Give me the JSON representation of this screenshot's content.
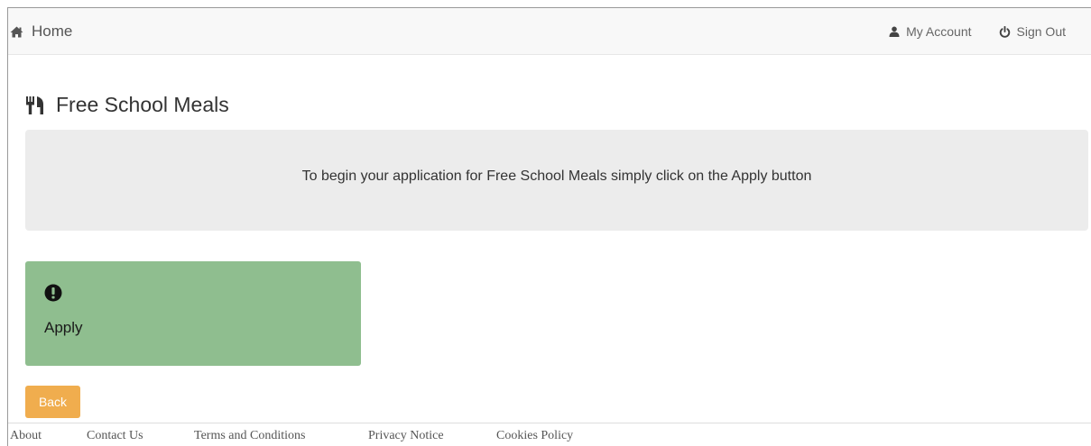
{
  "navbar": {
    "home_label": "Home",
    "home_icon": "home-icon",
    "account_label": "My Account",
    "account_icon": "user-icon",
    "signout_label": "Sign Out",
    "signout_icon": "power-icon"
  },
  "page": {
    "title": "Free School Meals",
    "title_icon": "cutlery-icon"
  },
  "info": {
    "text": "To begin your application for Free School Meals simply click on the Apply button"
  },
  "apply_tile": {
    "label": "Apply",
    "icon": "exclamation-circle-icon",
    "color": "#8fbe8f"
  },
  "back_button": {
    "label": "Back",
    "color": "#f0ad4e"
  },
  "footer": {
    "links": [
      "About",
      "Contact Us",
      "Terms and Conditions",
      "Privacy Notice",
      "Cookies Policy"
    ]
  }
}
